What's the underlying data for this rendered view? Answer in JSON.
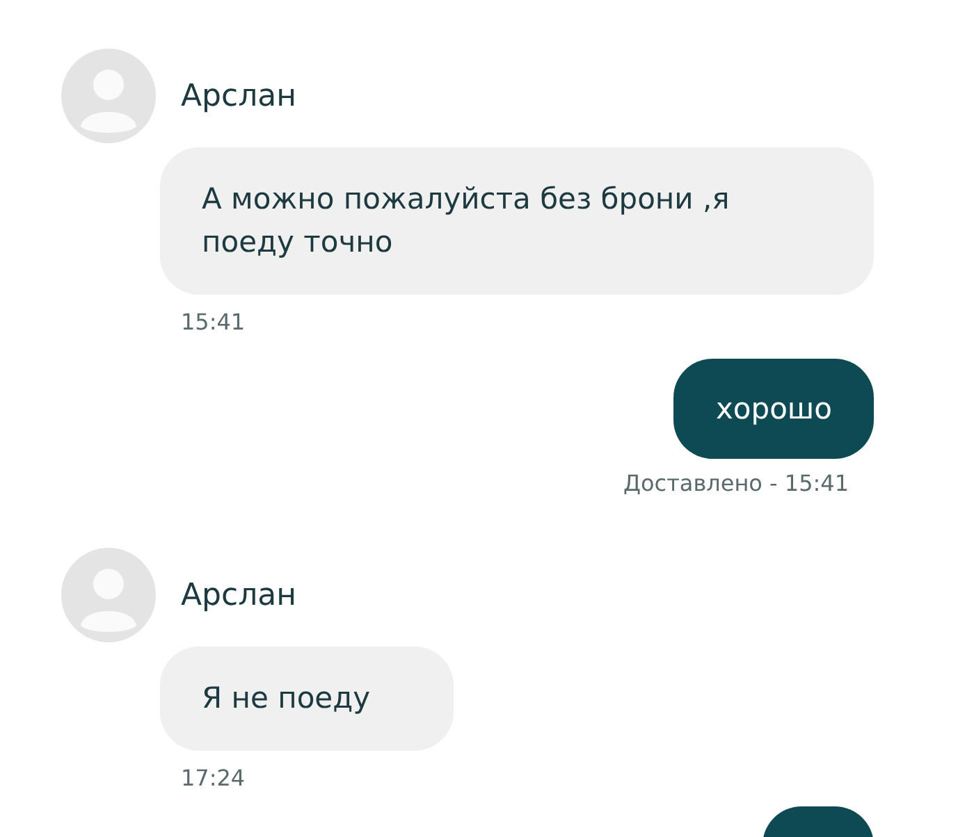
{
  "messages": [
    {
      "kind": "incoming",
      "sender": "Арслан",
      "text": "А можно пожалуйста без брони ,я поеду точно",
      "time": "15:41"
    },
    {
      "kind": "outgoing",
      "text": "хорошо",
      "status": "Доставлено - 15:41"
    },
    {
      "kind": "incoming",
      "sender": "Арслан",
      "text": "Я не поеду",
      "time": "17:24"
    },
    {
      "kind": "outgoing"
    }
  ]
}
